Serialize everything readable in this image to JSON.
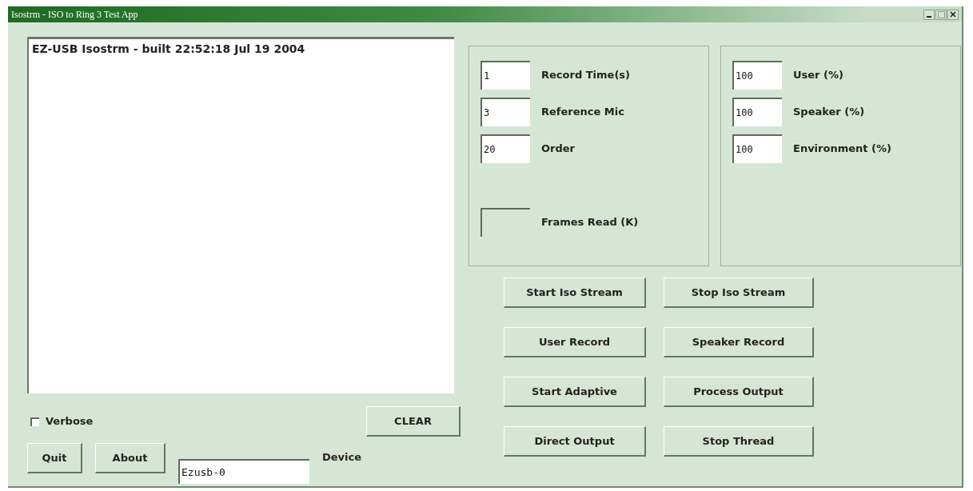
{
  "window": {
    "title": "Isostrm - ISO to Ring 3 Test App"
  },
  "log": {
    "lines": [
      "EZ-USB Isostrm - built 22:52:18 Jul 19 2004"
    ]
  },
  "verbose": {
    "label": "Verbose",
    "checked": false
  },
  "clear_button": "CLEAR",
  "bottom_buttons": [
    "Quit",
    "About"
  ],
  "device": {
    "value": "Ezusb-0",
    "label": "Device"
  },
  "settings_group": {
    "fields": [
      {
        "value": "1",
        "label": "Record Time(s)",
        "disabled": false
      },
      {
        "value": "3",
        "label": "Reference Mic",
        "disabled": false
      },
      {
        "value": "20",
        "label": "Order",
        "disabled": false
      }
    ],
    "readout": {
      "label": "Frames Read (K)",
      "disabled": true
    }
  },
  "level_group": {
    "fields": [
      {
        "value": "100",
        "label": "User (%)",
        "disabled": false
      },
      {
        "value": "100",
        "label": "Speaker (%)",
        "disabled": false
      },
      {
        "value": "100",
        "label": "Environment (%)",
        "disabled": false
      }
    ]
  },
  "action_buttons": [
    "Start Iso Stream",
    "Stop Iso Stream",
    "User Record",
    "Speaker Record",
    "Start Adaptive",
    "Process Output",
    "Direct Output",
    "Stop Thread"
  ]
}
